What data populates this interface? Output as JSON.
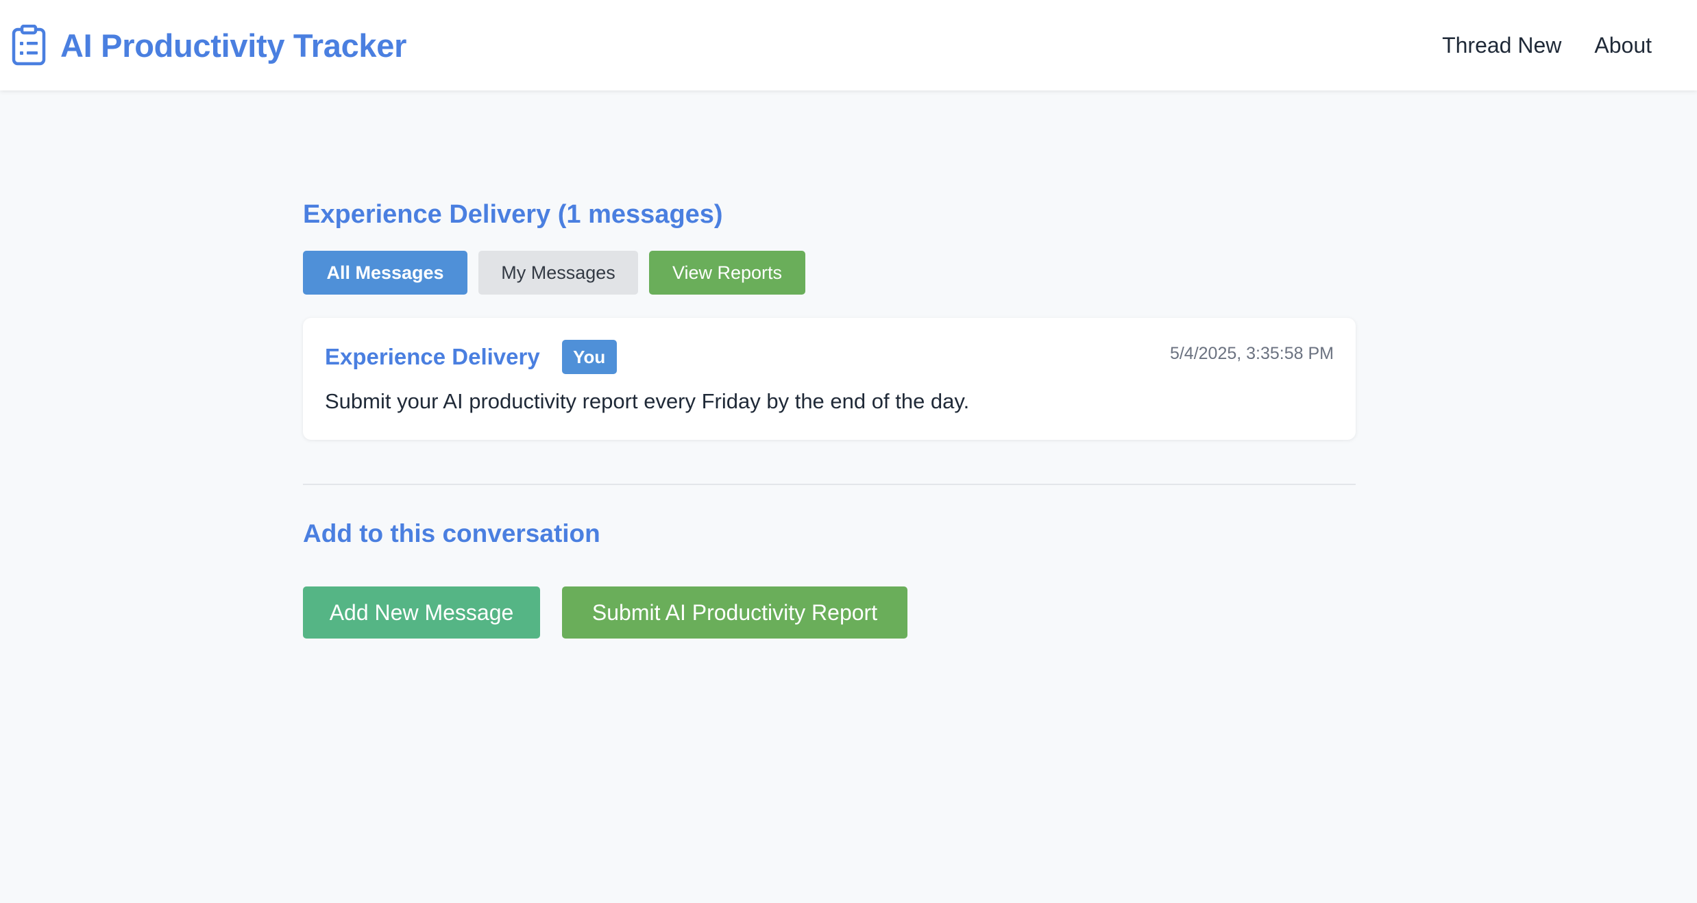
{
  "header": {
    "title": "AI Productivity Tracker",
    "icon": "clipboard-list-icon",
    "nav": [
      {
        "label": "Thread New"
      },
      {
        "label": "About"
      }
    ]
  },
  "thread": {
    "heading": "Experience Delivery (1 messages)",
    "filters": {
      "all": "All Messages",
      "mine": "My Messages",
      "reports": "View Reports"
    },
    "messages": [
      {
        "author": "Experience Delivery",
        "badge": "You",
        "timestamp": "5/4/2025, 3:35:58 PM",
        "body": "Submit your AI productivity report every Friday by the end of the day."
      }
    ]
  },
  "compose": {
    "heading": "Add to this conversation",
    "add_label": "Add New Message",
    "submit_label": "Submit AI Productivity Report"
  },
  "colors": {
    "brand": "#4a7fe0",
    "primary_button": "#4f90d8",
    "success": "#6aae5a",
    "teal": "#55b585",
    "background": "#f7f9fb"
  }
}
